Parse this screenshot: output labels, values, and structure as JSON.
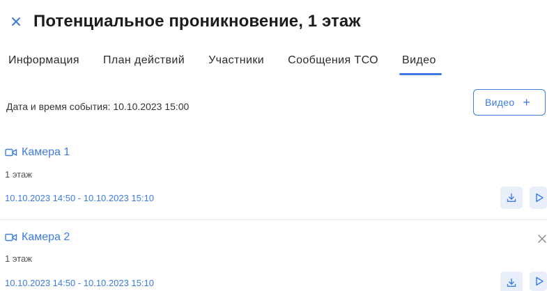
{
  "header": {
    "title": "Потенциальное проникновение, 1 этаж",
    "close_icon": "close-icon"
  },
  "tabs": [
    {
      "label": "Информация",
      "active": false
    },
    {
      "label": "План действий",
      "active": false
    },
    {
      "label": "Участники",
      "active": false
    },
    {
      "label": "Сообщения ТСО",
      "active": false
    },
    {
      "label": "Видео",
      "active": true
    }
  ],
  "event": {
    "datetime_label": "Дата и время события: 10.10.2023  15:00"
  },
  "video_add_button": {
    "label": "Видео",
    "plus": "+"
  },
  "cameras": [
    {
      "name": "Камера 1",
      "floor": "1 этаж",
      "range": "10.10.2023 14:50 - 10.10.2023 15:10"
    },
    {
      "name": "Камера 2",
      "floor": "1 этаж",
      "range": "10.10.2023  14:50 - 10.10.2023  15:10"
    }
  ],
  "colors": {
    "accent": "#3d7be0",
    "action_bg": "#e8effb",
    "divider": "#e4e4e4"
  },
  "icons": {
    "camera": "video-camera-icon",
    "download": "download-icon",
    "play": "play-icon",
    "remove": "close-icon"
  }
}
